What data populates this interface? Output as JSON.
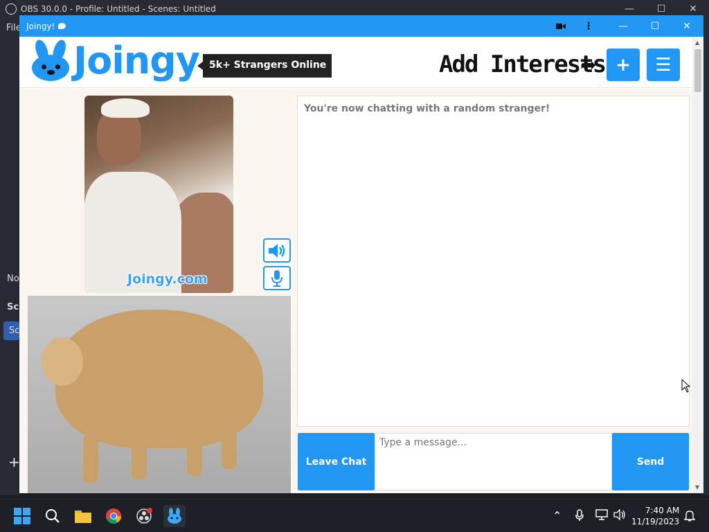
{
  "obs": {
    "title": "OBS 30.0.0 - Profile: Untitled - Scenes: Untitled",
    "menu_file": "File",
    "side_no": "No",
    "side_sc1": "Sc",
    "side_sc2": "Sc",
    "plus": "+"
  },
  "window": {
    "title": "Joingy!",
    "controls": {
      "camera": "camera-icon",
      "more": "⋮",
      "minimize": "—",
      "maximize": "☐",
      "close": "✕"
    }
  },
  "header": {
    "brand": "Joingy",
    "online_badge": "5k+ Strangers Online",
    "add_interests": "Add Interests",
    "plus_button": "+",
    "menu_button": "☰"
  },
  "video": {
    "watermark": "Joingy.com",
    "speaker_icon": "speaker-icon",
    "mic_icon": "microphone-icon"
  },
  "chat": {
    "status": "You're now chatting with a random stranger!",
    "leave_label": "Leave Chat",
    "input_placeholder": "Type a message...",
    "send_label": "Send"
  },
  "taskbar": {
    "time": "7:40 AM",
    "date": "11/19/2023"
  },
  "colors": {
    "accent": "#2196f3",
    "dark_badge": "#222222"
  }
}
